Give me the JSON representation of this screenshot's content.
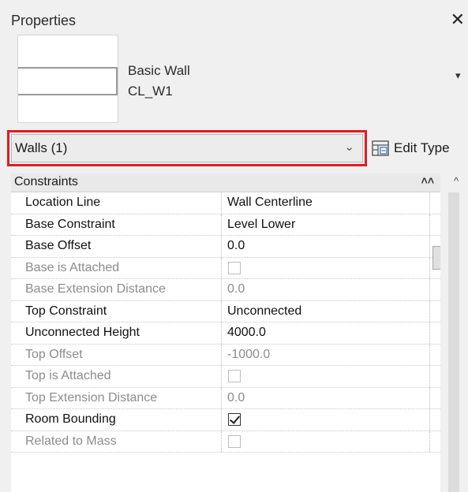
{
  "panel": {
    "title": "Properties",
    "close_glyph": "✕"
  },
  "type_selector": {
    "family": "Basic Wall",
    "type_name": "CL_W1",
    "dropdown_glyph": "▾"
  },
  "instance": {
    "filter_label": "Walls (1)",
    "chevron_glyph": "⌄",
    "edit_type_label": "Edit Type",
    "edit_type_icon": "edit-type-icon",
    "highlight_color": "#e01b24"
  },
  "grid": {
    "group": {
      "label": "Constraints",
      "collapse_glyph": "⌃⌃"
    },
    "rows": [
      {
        "name": "Location Line",
        "value": "Wall Centerline",
        "state": "active",
        "kind": "text"
      },
      {
        "name": "Base Constraint",
        "value": "Level Lower",
        "state": "active",
        "kind": "text"
      },
      {
        "name": "Base Offset",
        "value": "0.0",
        "state": "active",
        "kind": "text"
      },
      {
        "name": "Base is Attached",
        "value": "",
        "state": "disabled",
        "kind": "checkbox",
        "checked": false
      },
      {
        "name": "Base Extension Distance",
        "value": "0.0",
        "state": "disabled",
        "kind": "text"
      },
      {
        "name": "Top Constraint",
        "value": "Unconnected",
        "state": "active",
        "kind": "text"
      },
      {
        "name": "Unconnected Height",
        "value": "4000.0",
        "state": "active",
        "kind": "text"
      },
      {
        "name": "Top Offset",
        "value": "-1000.0",
        "state": "disabled",
        "kind": "text"
      },
      {
        "name": "Top is Attached",
        "value": "",
        "state": "disabled",
        "kind": "checkbox",
        "checked": false
      },
      {
        "name": "Top Extension Distance",
        "value": "0.0",
        "state": "disabled",
        "kind": "text"
      },
      {
        "name": "Room Bounding",
        "value": "",
        "state": "active",
        "kind": "checkbox",
        "checked": true
      },
      {
        "name": "Related to Mass",
        "value": "",
        "state": "disabled",
        "kind": "checkbox",
        "checked": false
      }
    ]
  },
  "scrollbar": {
    "up_glyph": "^"
  }
}
